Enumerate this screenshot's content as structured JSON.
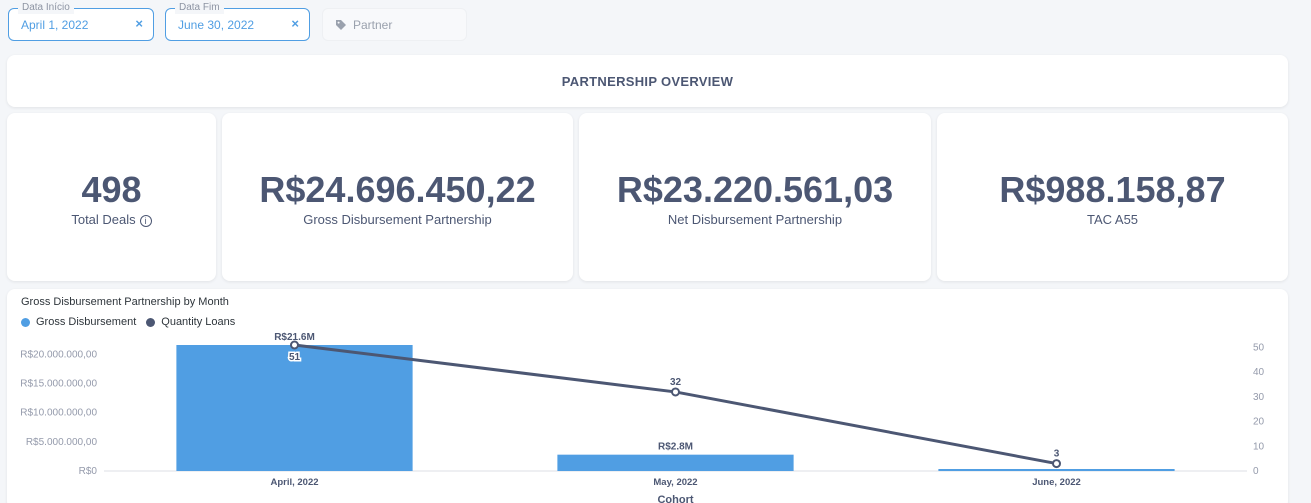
{
  "filters": {
    "start": {
      "label": "Data Início",
      "value": "April 1, 2022",
      "clear": "×"
    },
    "end": {
      "label": "Data Fim",
      "value": "June 30, 2022",
      "clear": "×"
    },
    "partner": {
      "placeholder": "Partner",
      "icon": "tag-icon"
    }
  },
  "overview_title": "PARTNERSHIP OVERVIEW",
  "kpis": [
    {
      "value": "498",
      "label": "Total Deals",
      "info_icon": "info-icon"
    },
    {
      "value": "R$24.696.450,22",
      "label": "Gross Disbursement Partnership"
    },
    {
      "value": "R$23.220.561,03",
      "label": "Net Disbursement Partnership"
    },
    {
      "value": "R$988.158,87",
      "label": "TAC A55"
    }
  ],
  "chart": {
    "title": "Gross Disbursement Partnership by Month",
    "legend": [
      {
        "name": "Gross Disbursement",
        "color": "#509ee3"
      },
      {
        "name": "Quantity Loans",
        "color": "#4c5773"
      }
    ]
  },
  "chart_data": {
    "type": "bar",
    "title": "Gross Disbursement Partnership by Month",
    "xlabel": "Cohort",
    "categories": [
      "April, 2022",
      "May, 2022",
      "June, 2022"
    ],
    "series": [
      {
        "name": "Gross Disbursement",
        "type": "bar",
        "axis": "left",
        "values": [
          21600000,
          2800000,
          150000
        ],
        "labels": [
          "R$21.6M",
          "R$2.8M",
          ""
        ],
        "color": "#509ee3"
      },
      {
        "name": "Quantity Loans",
        "type": "line",
        "axis": "right",
        "values": [
          51,
          32,
          3
        ],
        "labels": [
          "51",
          "32",
          "3"
        ],
        "color": "#4c5773"
      }
    ],
    "y_left": {
      "ticks": [
        "R$0",
        "R$5.000.000,00",
        "R$10.000.000,00",
        "R$15.000.000,00",
        "R$20.000.000,00"
      ],
      "tick_values": [
        0,
        5000000,
        10000000,
        15000000,
        20000000
      ],
      "ylim": [
        0,
        21600000
      ]
    },
    "y_right": {
      "ticks": [
        "0",
        "10",
        "20",
        "30",
        "40",
        "50"
      ],
      "tick_values": [
        0,
        10,
        20,
        30,
        40,
        50
      ],
      "ylim": [
        0,
        51
      ]
    },
    "legend_position": "top-left",
    "grid": false
  }
}
